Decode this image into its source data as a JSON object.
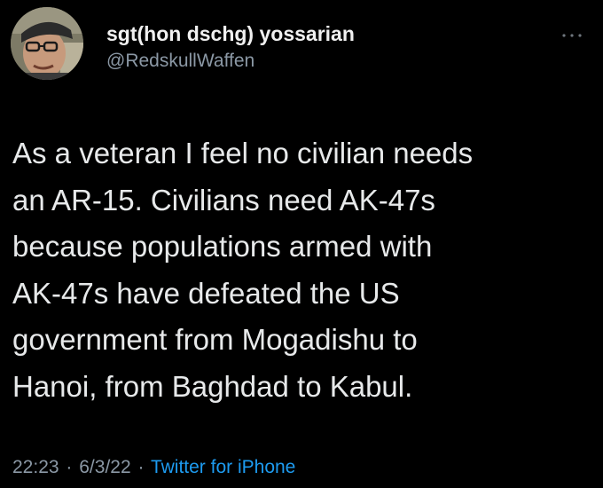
{
  "author": {
    "display_name": "sgt(hon dschg) yossarian",
    "handle": "@RedskullWaffen",
    "avatar_icon": "user-photo-avatar"
  },
  "more_icon": "ellipsis-icon",
  "tweet": {
    "lines": [
      "As a veteran I feel no civilian needs",
      "an AR-15. Civilians need AK-47s",
      "because populations armed with",
      "AK-47s have defeated the US",
      "government from Mogadishu to",
      "Hanoi, from Baghdad to Kabul."
    ]
  },
  "meta": {
    "time": "22:23",
    "date": "6/3/22",
    "separator": "·",
    "source": "Twitter for iPhone"
  },
  "colors": {
    "background": "#000000",
    "text": "#e7e9ea",
    "secondary": "#8b98a5",
    "link": "#1d9bf0"
  }
}
